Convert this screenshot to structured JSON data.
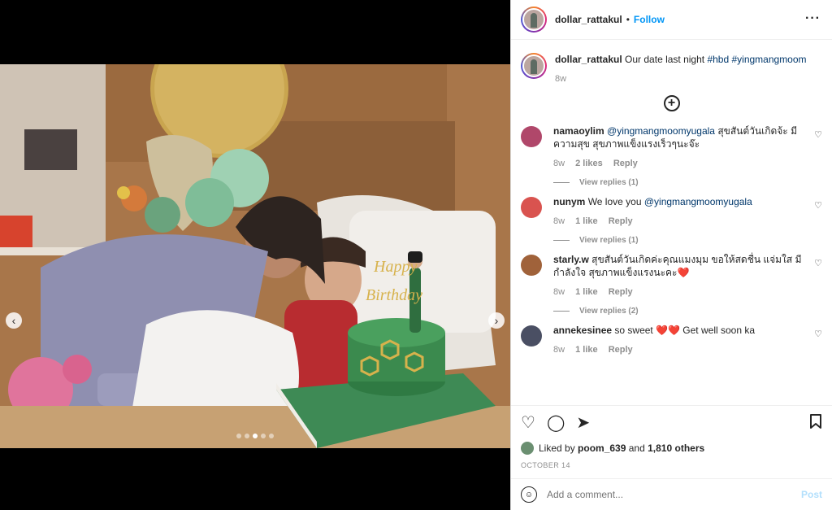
{
  "post": {
    "username": "dollar_rattakul",
    "follow_label": "Follow",
    "more_icon": "more-options-icon",
    "caption_text": "Our date last night",
    "caption_tags": "#hbd #yingmangmoom",
    "caption_age": "8w"
  },
  "media": {
    "prev_icon": "chevron-left-icon",
    "next_icon": "chevron-right-icon",
    "slide_count": 5,
    "active_slide": 3
  },
  "comments": [
    {
      "user": "namaoylim",
      "mention": "@yingmangmoomyugala",
      "text": "สุขสันต์วันเกิดจ้ะ มีความสุข สุขภาพแข็งแรงเร็วๆนะจ๊ะ",
      "age": "8w",
      "likes": "2 likes",
      "reply": "Reply",
      "view_replies": "View replies (1)",
      "avatar_color": "#b0476a"
    },
    {
      "user": "nunym",
      "mention": "",
      "text_before": "We love you",
      "mention_after": "@yingmangmoomyugala",
      "age": "8w",
      "likes": "1 like",
      "reply": "Reply",
      "view_replies": "View replies (1)",
      "avatar_color": "#d9534f"
    },
    {
      "user": "starly.w",
      "text": "สุขสันต์วันเกิดค่ะคุณแมงมุม ขอให้สดชื่น แจ่มใส มีกำลังใจ สุขภาพแข็งแรงนะคะ❤️",
      "age": "8w",
      "likes": "1 like",
      "reply": "Reply",
      "view_replies": "View replies (2)",
      "avatar_color": "#a0623a"
    },
    {
      "user": "annekesinee",
      "text": "so sweet ❤️❤️ Get well soon ka",
      "age": "8w",
      "likes": "1 like",
      "reply": "Reply",
      "avatar_color": "#4a4f63"
    }
  ],
  "actions": {
    "liked_by_prefix": "Liked by",
    "liked_by_user": "poom_639",
    "liked_and": "and",
    "others": "1,810 others",
    "date": "OCTOBER 14"
  },
  "add_comment": {
    "placeholder": "Add a comment...",
    "post_label": "Post"
  },
  "colors": {
    "accent": "#0095f6",
    "tag": "#00376b",
    "muted": "#8e8e8e"
  }
}
